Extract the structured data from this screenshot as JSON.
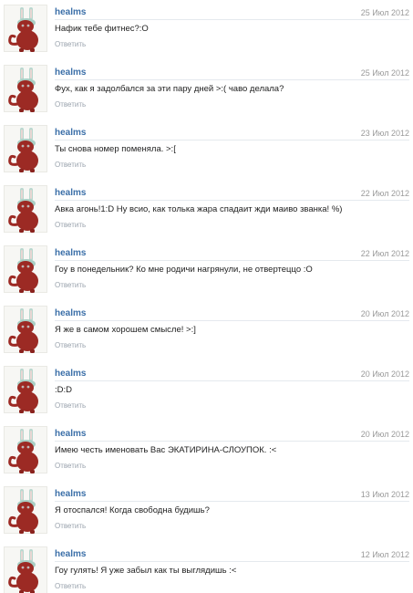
{
  "messages": [
    {
      "author": "healms",
      "date": "25 Июл 2012",
      "text": "Нафик тебе фитнес?:О",
      "reply_label": "Ответить"
    },
    {
      "author": "healms",
      "date": "25 Июл 2012",
      "text": "Фух, как я задолбался за эти пару дней >:( чаво делала?",
      "reply_label": "Ответить"
    },
    {
      "author": "healms",
      "date": "23 Июл 2012",
      "text": "Ты снова номер поменяла. >:[",
      "reply_label": "Ответить"
    },
    {
      "author": "healms",
      "date": "22 Июл 2012",
      "text": "Авка агонь!1:D Ну всио, как толька жара спадаит жди маиво званка! %)",
      "reply_label": "Ответить"
    },
    {
      "author": "healms",
      "date": "22 Июл 2012",
      "text": "Гоу в понедельник? Ко мне родичи нагрянули, не отвертеццо :О",
      "reply_label": "Ответить"
    },
    {
      "author": "healms",
      "date": "20 Июл 2012",
      "text": "Я же в самом хорошем смысле! >:]",
      "reply_label": "Ответить"
    },
    {
      "author": "healms",
      "date": "20 Июл 2012",
      "text": ":D:D",
      "reply_label": "Ответить"
    },
    {
      "author": "healms",
      "date": "20 Июл 2012",
      "text": "Имею честь именовать Вас ЭКАТИРИНА-СЛОУПОК. :<",
      "reply_label": "Ответить"
    },
    {
      "author": "healms",
      "date": "13 Июл 2012",
      "text": "Я отоспался! Когда свободна будишь?",
      "reply_label": "Ответить"
    },
    {
      "author": "healms",
      "date": "12 Июл 2012",
      "text": "Гоу гулять! Я уже забыл как ты выглядишь :<",
      "reply_label": "Ответить"
    }
  ],
  "avatar_icon": "red-cat-with-bunny-ears-icon",
  "colors": {
    "author": "#3b6fa8",
    "date": "#9a9a9a",
    "text": "#222222",
    "reply": "#9aa3ad",
    "divider": "#e5e9ee",
    "avatar_cat": "#9c2a24",
    "avatar_ears": "#a9cfc4"
  }
}
